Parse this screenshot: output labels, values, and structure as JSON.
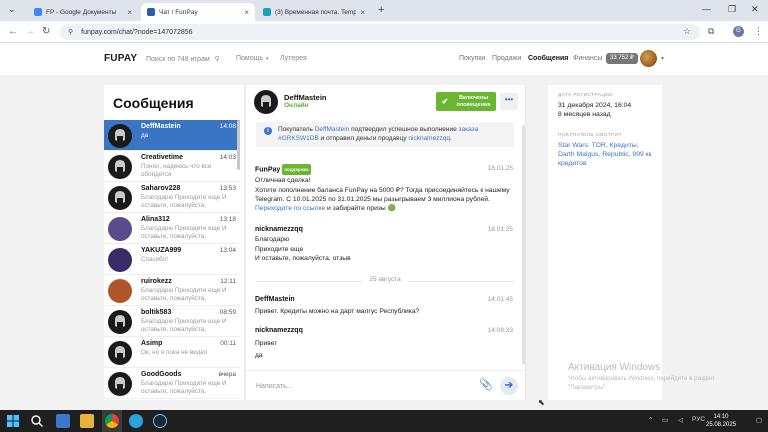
{
  "browser": {
    "tabs": [
      {
        "title": "FP - Google Документы",
        "active": false
      },
      {
        "title": "Чат / FunPay",
        "active": true
      },
      {
        "title": "(3) Временная почта. Temp e",
        "active": false
      }
    ],
    "url": "funpay.com/chat/?node=147072856"
  },
  "header": {
    "logo_fun": "FU",
    "logo_pay": "PAY",
    "search": "Поиск по 748 играм",
    "help": "Помощь",
    "travel": "Лутерея",
    "purchases": "Покупки",
    "sales": "Продажи",
    "messages": "Сообщения",
    "finance": "Финансы",
    "balance": "33 752 ₽"
  },
  "sidebar": {
    "title": "Сообщения",
    "contacts": [
      {
        "name": "DeffMastein",
        "time": "14:08",
        "preview": "да",
        "active": true,
        "avatar": "#1a1a1a"
      },
      {
        "name": "Creativetime",
        "time": "14:03",
        "preview": "Понял, надеюсь что все обойдется",
        "active": false,
        "avatar": "#1a1a1a"
      },
      {
        "name": "Saharov228",
        "time": "13:53",
        "preview": "Благодарю Приходите еще И оставьте, пожалуйста,",
        "active": false,
        "avatar": "#1a1a1a"
      },
      {
        "name": "Alina312",
        "time": "13:18",
        "preview": "Благодарю Приходите еще И оставьте, пожалуйста,",
        "active": false,
        "avatar": "#5b4a8a"
      },
      {
        "name": "YAKUZA999",
        "time": "13:04",
        "preview": "Спасибо!",
        "active": false,
        "avatar": "#3b2a6a"
      },
      {
        "name": "ruirokezz",
        "time": "12:11",
        "preview": "Благодарю Приходите еще И оставьте, пожалуйста,",
        "active": false,
        "avatar": "#b0552a"
      },
      {
        "name": "boltik583",
        "time": "08:59",
        "preview": "Благодарю Приходите еще И оставьте, пожалуйста,",
        "active": false,
        "avatar": "#1a1a1a"
      },
      {
        "name": "Asimp",
        "time": "00:11",
        "preview": "Ок, но я пока не видел",
        "active": false,
        "avatar": "#1a1a1a"
      },
      {
        "name": "GoodGoods",
        "time": "вчера",
        "preview": "Благодарю Приходите еще И оставьте, пожалуйста,",
        "active": false,
        "avatar": "#1a1a1a"
      }
    ]
  },
  "chat": {
    "name": "DeffMastein",
    "status": "Онлайн",
    "notif_line1": "Включены",
    "notif_line2": "оповещения",
    "more": "•••",
    "system": {
      "p1": "Покупатель ",
      "buyer": "DeffMastein",
      "p2": " подтвердил успешное выполнение ",
      "order": "заказа #GRKSW1DB",
      "p3": " и отправил деньги продавцу ",
      "seller": "nicknamezzqq",
      "p4": "."
    },
    "msg1": {
      "name": "FunPay",
      "badge": "поддержка",
      "time": "18.01.25",
      "l1": "Отличная сделка!",
      "l2": "Хотите пополнение баланса FunPay на 5000 ₽? Тогда присоединяйтесь к нашему Telegram. С 10.01.2025 по 31.01.2025 мы разыгрываем 3 миллиона рублей. ",
      "link": "Переходите по ссылке",
      "l3": " и забирайте призы 🟢"
    },
    "msg2": {
      "name": "nicknamezzqq",
      "time": "18.01.25",
      "l1": "Благодарю",
      "l2": "Приходите еще",
      "l3": "И оставьте, пожалуйста, отзыв"
    },
    "date_divider": "25 августа",
    "msg3": {
      "name": "DeffMastein",
      "time": "14:01:45",
      "l1": "Привет. Кредиты можно на дарт малгус Республика?"
    },
    "msg4": {
      "name": "nicknamezzqq",
      "time": "14:08:33",
      "l1": "Привет",
      "l2": "да"
    },
    "input_placeholder": "Написать..."
  },
  "right": {
    "reg_label": "ДАТА РЕГИСТРАЦИИ",
    "reg_date": "31 декабря 2024, 16:04",
    "reg_ago": "8 месяцев назад",
    "viewing_label": "ПОКУПАТЕЛЬ СМОТРИТ",
    "viewing": "Star Wars: TOR, Кредиты, Darth Malgus, Republic, 999 кк кредитов"
  },
  "watermark": {
    "line1": "Активация Windows",
    "line2": "Чтобы активировать Windows, перейдите в раздел \"Параметры\"."
  },
  "taskbar": {
    "lang": "РУС",
    "time": "14:10",
    "date": "25.08.2025"
  }
}
